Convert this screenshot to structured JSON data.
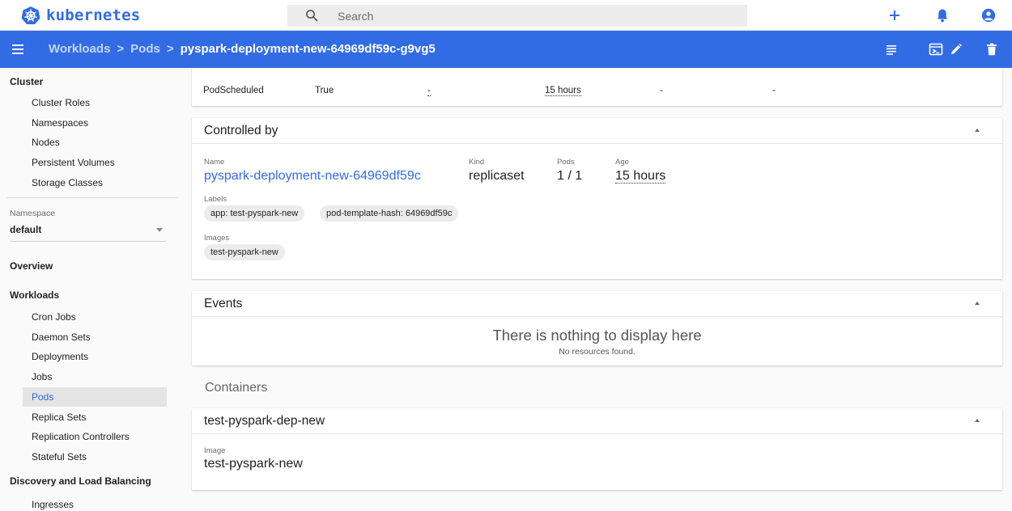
{
  "app": {
    "name": "kubernetes"
  },
  "search": {
    "placeholder": "Search"
  },
  "top_actions": [
    {
      "name": "add-icon"
    },
    {
      "name": "bell-icon"
    },
    {
      "name": "account-icon"
    }
  ],
  "breadcrumb": {
    "items": [
      "Workloads",
      "Pods"
    ],
    "separator": ">",
    "current": "pyspark-deployment-new-64969df59c-g9vg5"
  },
  "toolbar_actions": [
    "logs-icon",
    "exec-icon",
    "edit-icon",
    "delete-icon"
  ],
  "sidebar": {
    "cluster": {
      "heading": "Cluster",
      "items": [
        "Cluster Roles",
        "Namespaces",
        "Nodes",
        "Persistent Volumes",
        "Storage Classes"
      ]
    },
    "namespace": {
      "label": "Namespace",
      "value": "default"
    },
    "overview": "Overview",
    "workloads": {
      "heading": "Workloads",
      "items": [
        "Cron Jobs",
        "Daemon Sets",
        "Deployments",
        "Jobs",
        "Pods",
        "Replica Sets",
        "Replication Controllers",
        "Stateful Sets"
      ],
      "active": "Pods"
    },
    "discovery": {
      "heading": "Discovery and Load Balancing",
      "items": [
        "Ingresses"
      ]
    }
  },
  "conditions": {
    "row": [
      "PodScheduled",
      "True",
      "-",
      "15 hours",
      "-",
      "-"
    ]
  },
  "controlled_by": {
    "title": "Controlled by",
    "name_label": "Name",
    "name": "pyspark-deployment-new-64969df59c",
    "kind_label": "Kind",
    "kind": "replicaset",
    "pods_label": "Pods",
    "pods": "1 / 1",
    "age_label": "Age",
    "age": "15 hours",
    "labels_label": "Labels",
    "labels": [
      "app: test-pyspark-new",
      "pod-template-hash: 64969df59c"
    ],
    "images_label": "Images",
    "images": [
      "test-pyspark-new"
    ]
  },
  "events": {
    "title": "Events",
    "empty_title": "There is nothing to display here",
    "empty_sub": "No resources found."
  },
  "containers": {
    "section_title": "Containers",
    "items": [
      {
        "name": "test-pyspark-dep-new",
        "image_label": "Image",
        "image": "test-pyspark-new"
      }
    ]
  },
  "colors": {
    "primary": "#326ce5",
    "chip": "#ececec"
  }
}
